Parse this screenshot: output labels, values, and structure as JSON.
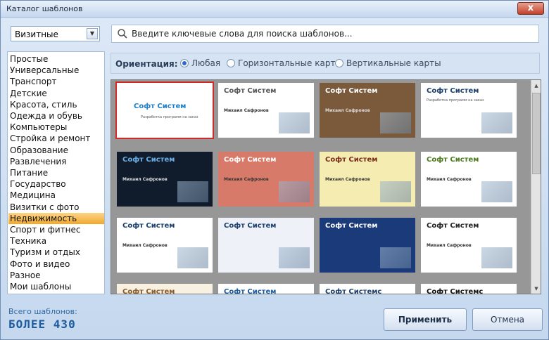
{
  "window": {
    "title": "Каталог шаблонов",
    "close": "x"
  },
  "combo": {
    "value": "Визитные",
    "arrow": "▼"
  },
  "search": {
    "placeholder": "Введите ключевые слова для поиска шаблонов..."
  },
  "categories": [
    "Простые",
    "Универсальные",
    "Транспорт",
    "Детские",
    "Красота, стиль",
    "Одежда и обувь",
    "Компьютеры",
    "Стройка и ремонт",
    "Образование",
    "Развлечения",
    "Питание",
    "Государство",
    "Медицина",
    "Визитки с фото",
    "Недвижимость",
    "Спорт и фитнес",
    "Техника",
    "Туризм и отдых",
    "Фото и видео",
    "Разное",
    "Мои шаблоны"
  ],
  "selected_category": 14,
  "orientation": {
    "label": "Ориентация:",
    "options": [
      "Любая",
      "Горизонтальные карты",
      "Вертикальные карты"
    ],
    "selected": 0
  },
  "cards": [
    {
      "title": "Софт Систем",
      "sub": "Разработка программ на заказ",
      "name": "",
      "accent": "#1d7fc8",
      "bg": "#ffffff"
    },
    {
      "title": "Софт Систем",
      "sub": "",
      "name": "Михаил Сафронов",
      "accent": "#555555",
      "bg": "#ffffff"
    },
    {
      "title": "Софт Систем",
      "sub": "",
      "name": "Михаил Сафронов",
      "accent": "#ffffff",
      "bg": "#7a5a3a"
    },
    {
      "title": "Софт Систем",
      "sub": "Разработка программ на заказ",
      "name": "",
      "accent": "#1a3e6e",
      "bg": "#ffffff"
    },
    {
      "title": "Софт Систем",
      "sub": "",
      "name": "Михаил Сафронов",
      "accent": "#6ab0e8",
      "bg": "#101c2c"
    },
    {
      "title": "Софт Систем",
      "sub": "",
      "name": "Михаил Сафронов",
      "accent": "#ffffff",
      "bg": "#d87a6a"
    },
    {
      "title": "Софт Систем",
      "sub": "",
      "name": "Михаил Сафронов",
      "accent": "#7a2a1a",
      "bg": "#f4ecb0"
    },
    {
      "title": "Софт Систем",
      "sub": "",
      "name": "Михаил Сафронов",
      "accent": "#4a7a1a",
      "bg": "#ffffff"
    },
    {
      "title": "Софт Систем",
      "sub": "",
      "name": "Михаил Сафронов",
      "accent": "#1a3e6e",
      "bg": "#ffffff"
    },
    {
      "title": "Софт Систем",
      "sub": "",
      "name": "",
      "accent": "#1a3e6e",
      "bg": "#eef2f8"
    },
    {
      "title": "Софт Систем",
      "sub": "",
      "name": "",
      "accent": "#ffffff",
      "bg": "#1a3a7a"
    },
    {
      "title": "Софт Систем",
      "sub": "",
      "name": "Михаил Сафронов",
      "accent": "#222222",
      "bg": "#ffffff"
    },
    {
      "title": "Софт Систем",
      "sub": "",
      "name": "",
      "accent": "#8a5a2a",
      "bg": "#f8f0e0"
    },
    {
      "title": "Софт Систем",
      "sub": "",
      "name": "",
      "accent": "#1a5aa0",
      "bg": "#ffffff"
    },
    {
      "title": "Софт Системс",
      "sub": "",
      "name": "",
      "accent": "#1a3e6e",
      "bg": "#ffffff"
    },
    {
      "title": "Софт Системс",
      "sub": "",
      "name": "",
      "accent": "#111111",
      "bg": "#ffffff"
    }
  ],
  "footer": {
    "line1": "Всего шаблонов:",
    "line2": "БОЛЕЕ 430"
  },
  "buttons": {
    "apply": "Применить",
    "cancel": "Отмена"
  }
}
